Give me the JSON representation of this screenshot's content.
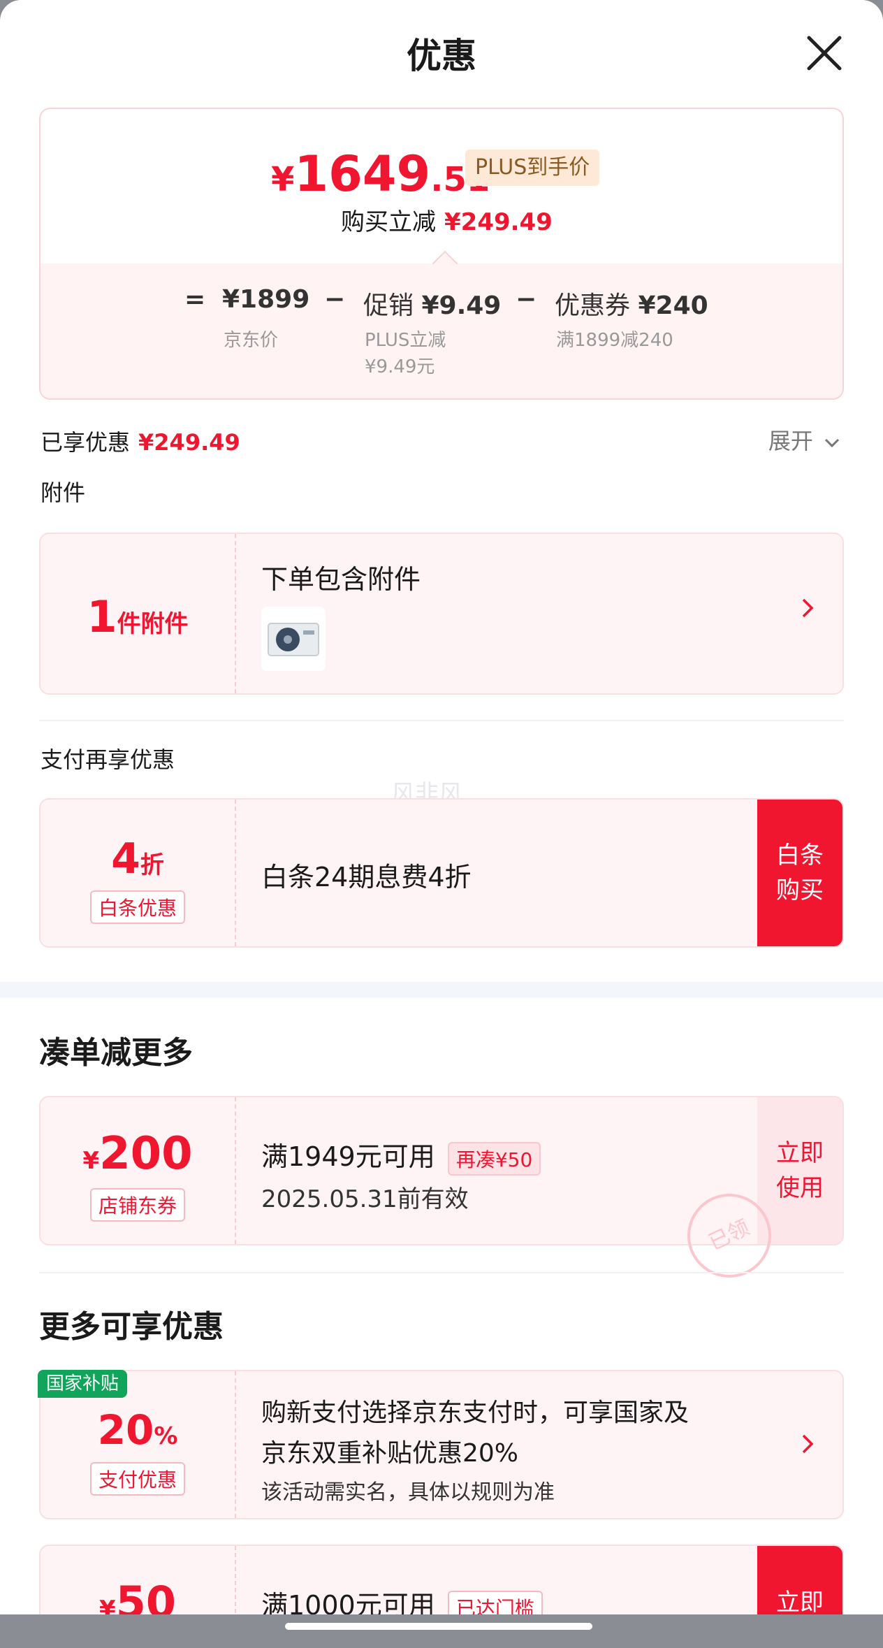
{
  "header": {
    "title": "优惠"
  },
  "price_summary": {
    "currency": "¥",
    "final_integer": "1649",
    "final_decimal": ".51",
    "plus_tag": "PLUS到手价",
    "instant_label": "购买立减",
    "instant_amount": "¥249.49",
    "equals": "=",
    "minus": "−",
    "jd_price": "¥1899",
    "jd_price_label": "京东价",
    "promo_label": "促销",
    "promo_amount": "¥9.49",
    "promo_sub1": "PLUS立减",
    "promo_sub2": "¥9.49元",
    "coupon_label": "优惠券",
    "coupon_amount": "¥240",
    "coupon_sub": "满1899减240"
  },
  "enjoyed": {
    "label": "已享优惠",
    "amount": "¥249.49",
    "expand_label": "展开"
  },
  "accessories": {
    "section_title": "附件",
    "count": "1",
    "count_unit": "件附件",
    "title": "下单包含附件"
  },
  "pay_discount": {
    "section_title": "支付再享优惠",
    "value": "4",
    "unit": "折",
    "tag": "白条优惠",
    "text": "白条24期息费4折",
    "button_line1": "白条",
    "button_line2": "购买"
  },
  "watermark": "风非风",
  "combine": {
    "section_title": "凑单减更多",
    "currency": "¥",
    "value": "200",
    "tag": "店铺东券",
    "condition": "满1949元可用",
    "extra_tag": "再凑¥50",
    "valid": "2025.05.31前有效",
    "stamp": "已领",
    "button_line1": "立即",
    "button_line2": "使用"
  },
  "more": {
    "section_title": "更多可享优惠",
    "subsidy": {
      "badge": "国家补贴",
      "value": "20",
      "unit": "%",
      "tag": "支付优惠",
      "line1": "购新支付选择京东支付时，可享国家及",
      "line2": "京东双重补贴优惠20%",
      "note": "该活动需实名，具体以规则为准"
    },
    "coupon50": {
      "currency": "¥",
      "value": "50",
      "condition": "满1000元可用",
      "tag": "已达门槛",
      "button_line1": "立即"
    }
  }
}
